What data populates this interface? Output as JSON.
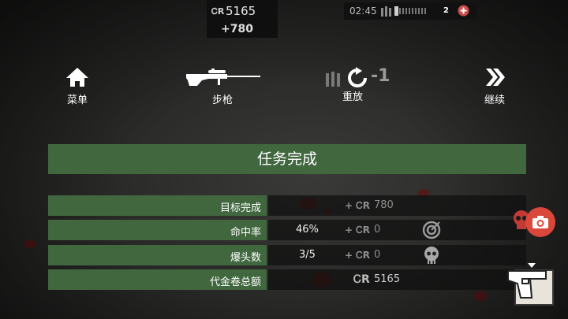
{
  "hud": {
    "currency_symbol": "ᏟR",
    "credits": "5165",
    "credits_gain": "+780",
    "timer": "02:45",
    "lives": "2"
  },
  "actions": [
    {
      "label": "菜单",
      "icon": "home-icon"
    },
    {
      "label": "步枪",
      "icon": "rifle-icon"
    },
    {
      "label": "重放",
      "icon": "reload-icon",
      "extra": "-1"
    },
    {
      "label": "继续",
      "icon": "double-chevron-right-icon"
    }
  ],
  "banner": {
    "title": "任务完成"
  },
  "stats": [
    {
      "label": "目标完成",
      "value": "",
      "plus": "+ ᏟR",
      "amount": "780"
    },
    {
      "label": "命中率",
      "value": "46%",
      "plus": "+ ᏟR",
      "amount": "0"
    },
    {
      "label": "爆头数",
      "value": "3/5",
      "plus": "+ ᏟR",
      "amount": "0"
    },
    {
      "label": "代金卷总额",
      "value": "",
      "plus": "ᏟR",
      "amount": "5165"
    }
  ],
  "colors": {
    "accent_green": "#41673f",
    "camera_red": "#d9483a"
  }
}
